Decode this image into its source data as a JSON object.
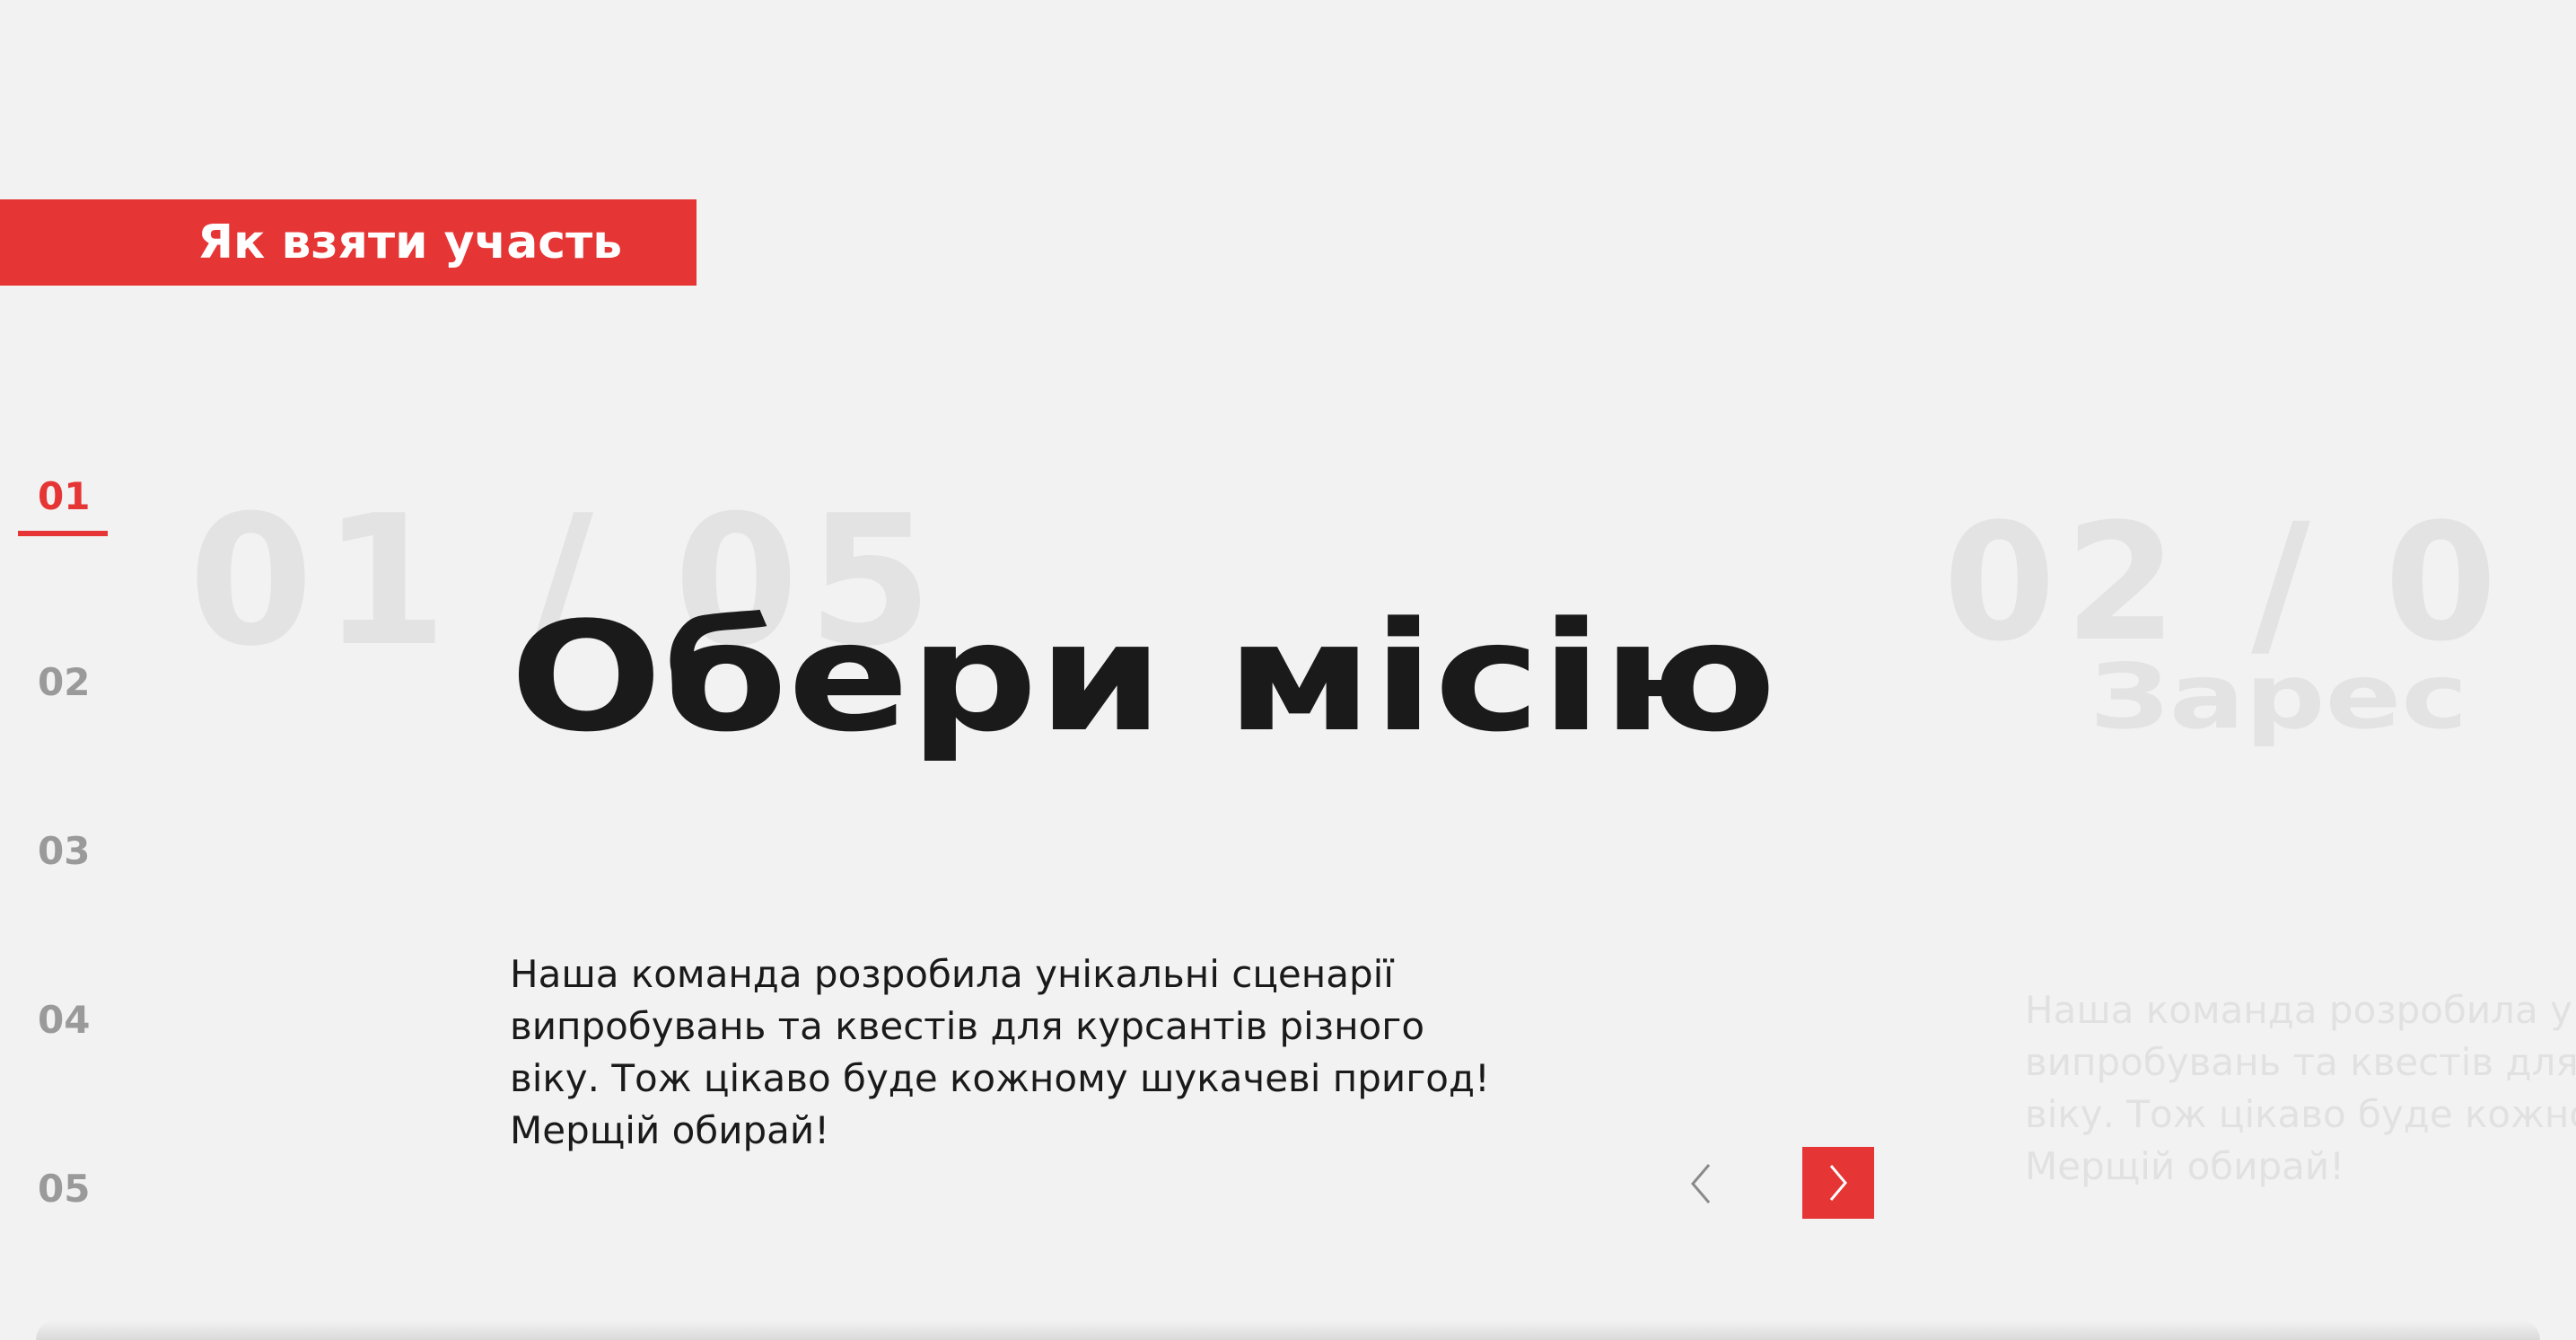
{
  "section": {
    "title": "Як взяти участь"
  },
  "steps": [
    {
      "label": "01",
      "active": true
    },
    {
      "label": "02",
      "active": false
    },
    {
      "label": "03",
      "active": false
    },
    {
      "label": "04",
      "active": false
    },
    {
      "label": "05",
      "active": false
    }
  ],
  "slides": [
    {
      "counter": "01 / 05",
      "title": "Обери місію",
      "description_lines": [
        "Наша команда розробила унікальні сценарії",
        "випробувань та квестів для курсантів різного",
        "віку. Тож цікаво буде кожному шукачеві пригод!",
        "Мерщій обирай!"
      ]
    },
    {
      "counter": "02 / 0",
      "title": "Зарес",
      "description_lines": [
        "Наша команда розробила у",
        "випробувань та квестів для",
        "віку. Тож цікаво буде кожно",
        "Мерщій обирай!"
      ]
    }
  ],
  "icons": {
    "prev": "chevron-left-icon",
    "next": "chevron-right-icon"
  },
  "colors": {
    "accent": "#e63535",
    "background": "#f2f2f2",
    "text": "#1a1a1a",
    "muted": "#9a9a9a",
    "faded": "#e3e3e3"
  }
}
